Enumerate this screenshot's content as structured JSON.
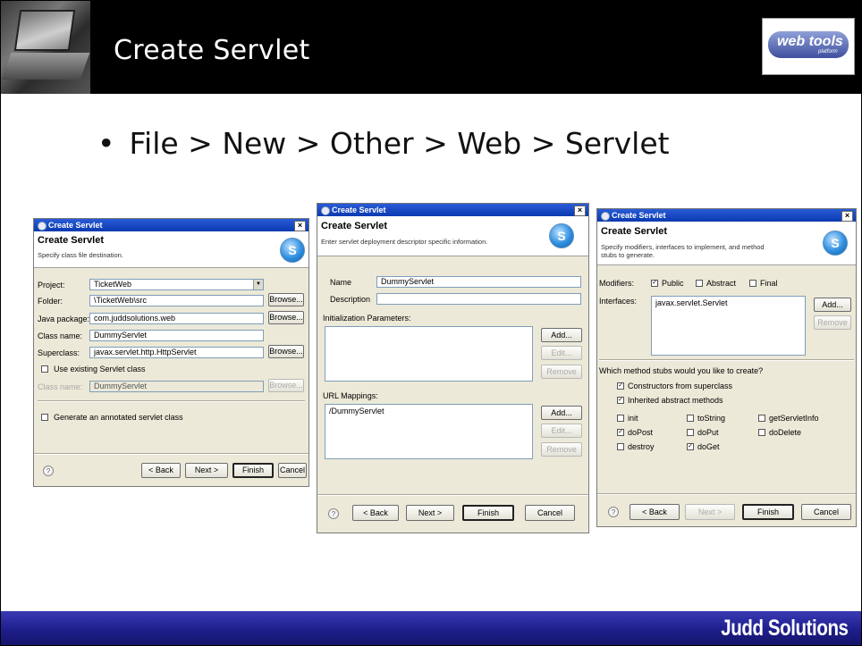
{
  "slide": {
    "title": "Create Servlet",
    "bullet": "File > New > Other > Web > Servlet",
    "logo_text": "web tools",
    "logo_sub": "platform",
    "footer_logo": "Judd Solutions"
  },
  "dialog1": {
    "window_title": "Create Servlet",
    "header_title": "Create Servlet",
    "header_desc": "Specify class file destination.",
    "project_label": "Project:",
    "project_value": "TicketWeb",
    "folder_label": "Folder:",
    "folder_value": "\\TicketWeb\\src",
    "package_label": "Java package:",
    "package_value": "com.juddsolutions.web",
    "classname_label": "Class name:",
    "classname_value": "DummyServlet",
    "superclass_label": "Superclass:",
    "superclass_value": "javax.servlet.http.HttpServlet",
    "browse": "Browse...",
    "use_existing": "Use existing Servlet class",
    "existing_class_label": "Class name:",
    "existing_class_value": "DummyServlet",
    "generate_annotated": "Generate an annotated servlet class",
    "back": "< Back",
    "next": "Next >",
    "finish": "Finish",
    "cancel": "Cancel"
  },
  "dialog2": {
    "window_title": "Create Servlet",
    "header_title": "Create Servlet",
    "header_desc": "Enter servlet deployment descriptor specific information.",
    "name_label": "Name",
    "name_value": "DummyServlet",
    "description_label": "Description",
    "description_value": "",
    "init_params_label": "Initialization Parameters:",
    "url_mappings_label": "URL Mappings:",
    "url_mappings": [
      "/DummyServlet"
    ],
    "add": "Add...",
    "edit": "Edit...",
    "remove": "Remove",
    "back": "< Back",
    "next": "Next >",
    "finish": "Finish",
    "cancel": "Cancel"
  },
  "dialog3": {
    "window_title": "Create Servlet",
    "header_title": "Create Servlet",
    "header_desc_1": "Specify modifiers, interfaces to implement, and method",
    "header_desc_2": "stubs to generate.",
    "modifiers_label": "Modifiers:",
    "mod_public": "Public",
    "mod_abstract": "Abstract",
    "mod_final": "Final",
    "interfaces_label": "Interfaces:",
    "interfaces": [
      "javax.servlet.Servlet"
    ],
    "add": "Add...",
    "remove": "Remove",
    "stubs_question": "Which method stubs would you like to create?",
    "constructors": "Constructors from superclass",
    "inherited": "Inherited abstract methods",
    "m_init": "init",
    "m_tostring": "toString",
    "m_getservletinfo": "getServletInfo",
    "m_dopost": "doPost",
    "m_doput": "doPut",
    "m_dodelete": "doDelete",
    "m_destroy": "destroy",
    "m_doget": "doGet",
    "back": "< Back",
    "next": "Next >",
    "finish": "Finish",
    "cancel": "Cancel",
    "checked_glyph": "✓"
  }
}
